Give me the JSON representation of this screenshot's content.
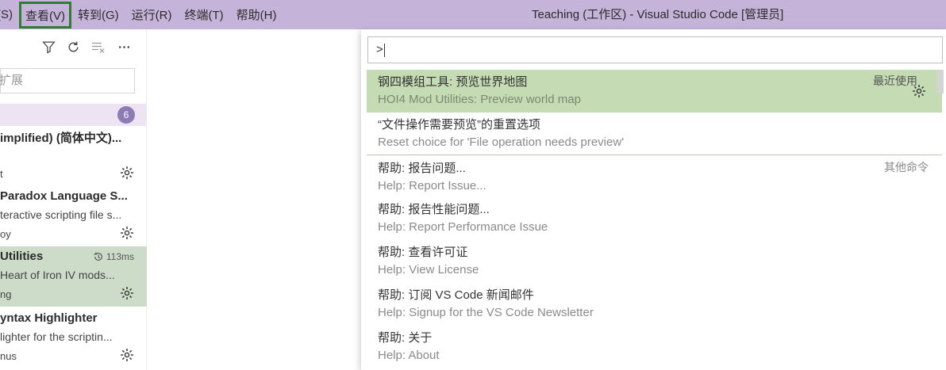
{
  "menu": {
    "items": [
      {
        "label": "(S)",
        "active": false
      },
      {
        "label": "查看(V)",
        "active": true
      },
      {
        "label": "转到(G)",
        "active": false
      },
      {
        "label": "运行(R)",
        "active": false
      },
      {
        "label": "终端(T)",
        "active": false
      },
      {
        "label": "帮助(H)",
        "active": false
      }
    ]
  },
  "window_title": "Teaching (工作区) - Visual Studio Code [管理员]",
  "sidebar": {
    "toolbar_icons": [
      "filter-icon",
      "refresh-icon",
      "clear-list-icon",
      "more-icon"
    ],
    "search_placeholder": "扩展",
    "section_count": "6",
    "extensions": [
      {
        "name": "implified) (简体中文)...",
        "desc": "",
        "publisher": "t",
        "time": ""
      },
      {
        "name": "Paradox Language S...",
        "desc": "teractive scripting file s...",
        "publisher": "oy",
        "time": ""
      },
      {
        "name": " Utilities",
        "desc": " Heart of Iron IV mods...",
        "publisher": "ng",
        "time": "113ms"
      },
      {
        "name": "yntax Highlighter",
        "desc": "lighter for the scriptin...",
        "publisher": "nus",
        "time": ""
      }
    ]
  },
  "palette": {
    "input_value": ">",
    "items": [
      {
        "label": "钢四模组工具: 预览世界地图",
        "detail": "HOI4 Mod Utilities: Preview world map",
        "group": "最近使用"
      },
      {
        "label": "“文件操作需要预览”的重置选项",
        "detail": "Reset choice for 'File operation needs preview'",
        "group": ""
      },
      {
        "label": "帮助: 报告问题...",
        "detail": "Help: Report Issue...",
        "group": "其他命令"
      },
      {
        "label": "帮助: 报告性能问题...",
        "detail": "Help: Report Performance Issue",
        "group": ""
      },
      {
        "label": "帮助: 查看许可证",
        "detail": "Help: View License",
        "group": ""
      },
      {
        "label": "帮助: 订阅 VS Code 新闻邮件",
        "detail": "Help: Signup for the VS Code Newsletter",
        "group": ""
      },
      {
        "label": "帮助: 关于",
        "detail": "Help: About",
        "group": ""
      }
    ]
  },
  "colors": {
    "titlebar": "#c5b3d9",
    "selection": "#c5dbb3",
    "active_menu_outline": "#2e7d32",
    "badge": "#8e7ab5"
  }
}
